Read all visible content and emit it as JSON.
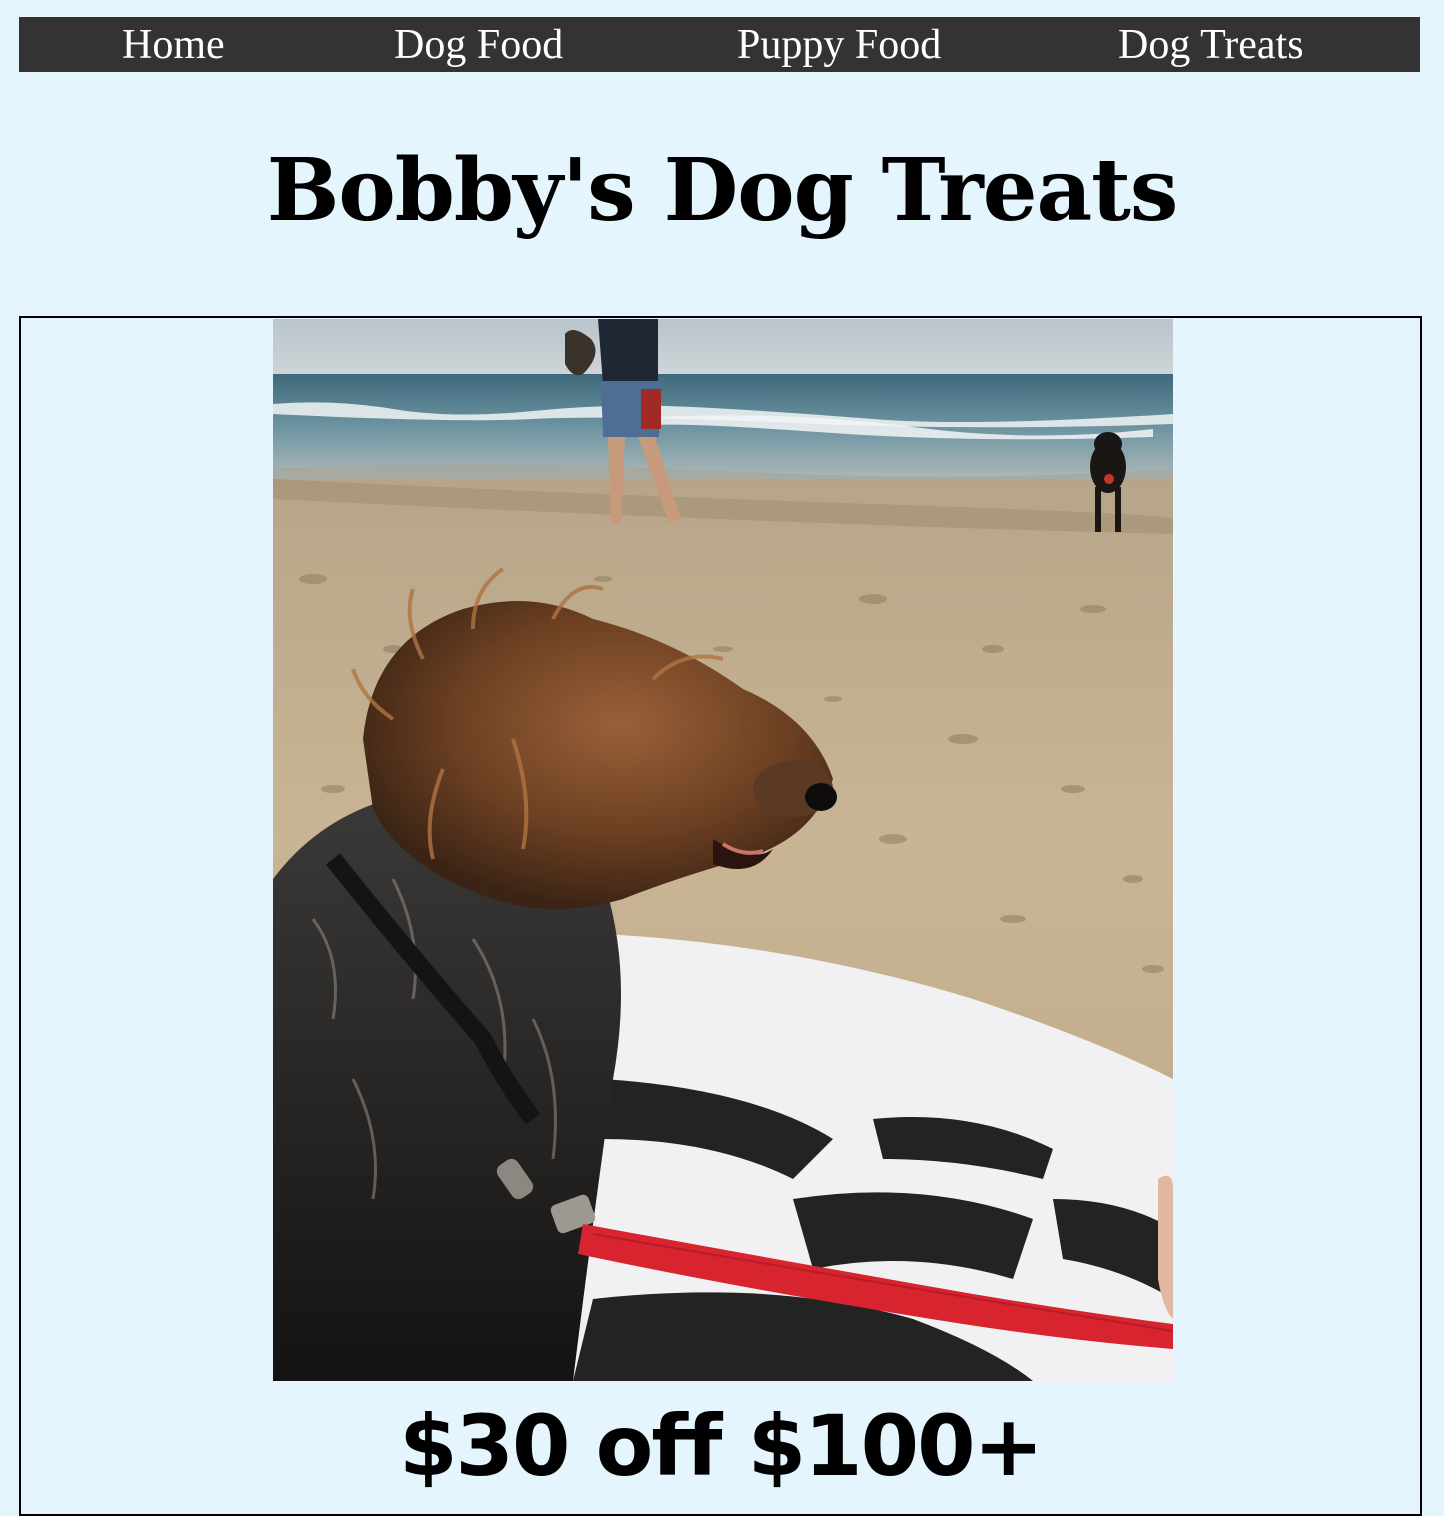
{
  "nav": {
    "items": [
      {
        "label": "Home"
      },
      {
        "label": "Dog Food"
      },
      {
        "label": "Puppy Food"
      },
      {
        "label": "Dog Treats"
      }
    ]
  },
  "header": {
    "title": "Bobby's Dog Treats"
  },
  "promo": {
    "image_alt": "",
    "headline": "$30 off $100+"
  },
  "colors": {
    "page_background": "#e4f5fd",
    "nav_background": "#333333",
    "nav_text": "#ffffff",
    "leash": "#d8242f"
  }
}
